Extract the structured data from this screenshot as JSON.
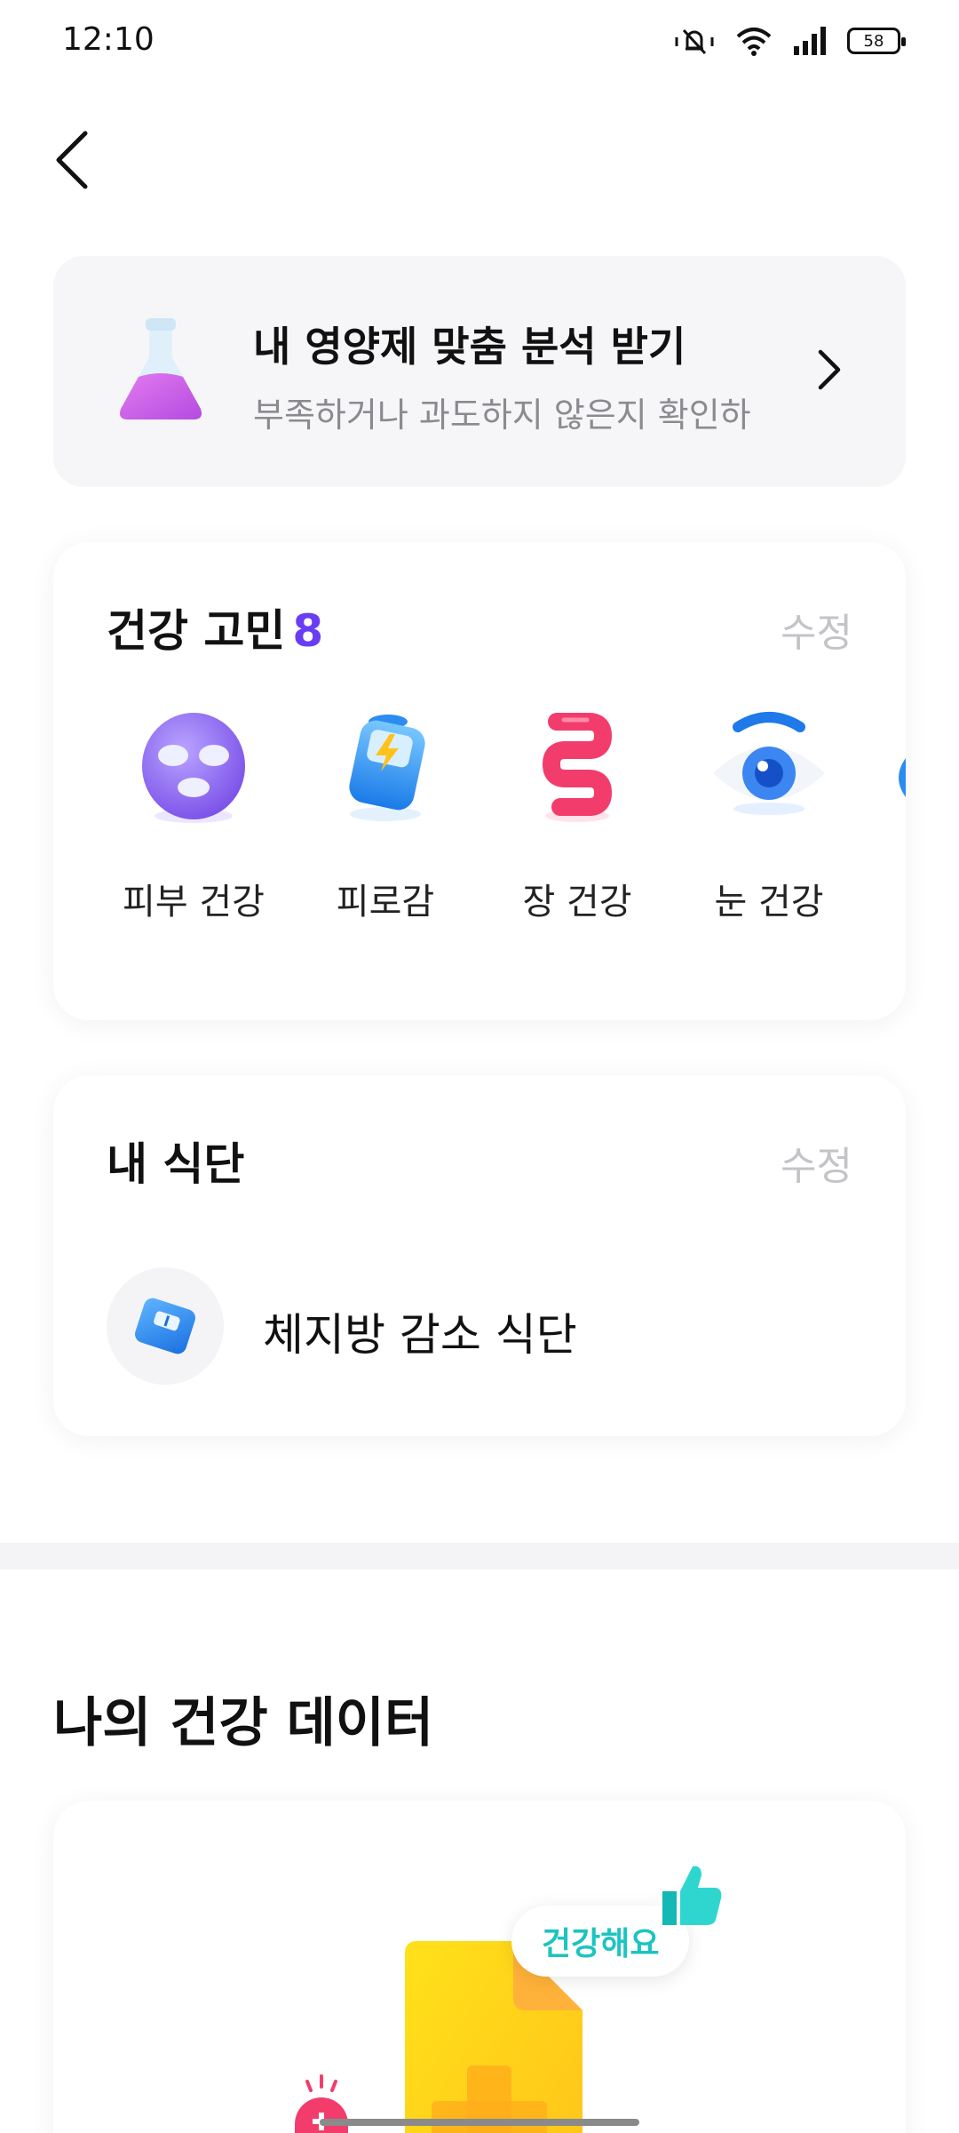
{
  "status_bar": {
    "time": "12:10",
    "battery": "58"
  },
  "promo": {
    "title": "내 영양제 맞춤 분석 받기",
    "subtitle": "부족하거나 과도하지 않은지 확인하"
  },
  "concerns": {
    "title": "건강 고민",
    "count": "8",
    "edit_label": "수정",
    "items": [
      {
        "label": "피부 건강",
        "icon": "face-mask-icon"
      },
      {
        "label": "피로감",
        "icon": "battery-charge-icon"
      },
      {
        "label": "장 건강",
        "icon": "intestine-icon"
      },
      {
        "label": "눈 건강",
        "icon": "eye-icon"
      }
    ]
  },
  "diet": {
    "title": "내 식단",
    "edit_label": "수정",
    "item_label": "체지방 감소 식단",
    "item_icon": "scale-icon"
  },
  "health_data": {
    "title": "나의 건강 데이터",
    "badge": "건강해요"
  },
  "colors": {
    "accent": "#6a3df5",
    "teal": "#1cc4c0",
    "card_bg": "#f6f6f8"
  }
}
